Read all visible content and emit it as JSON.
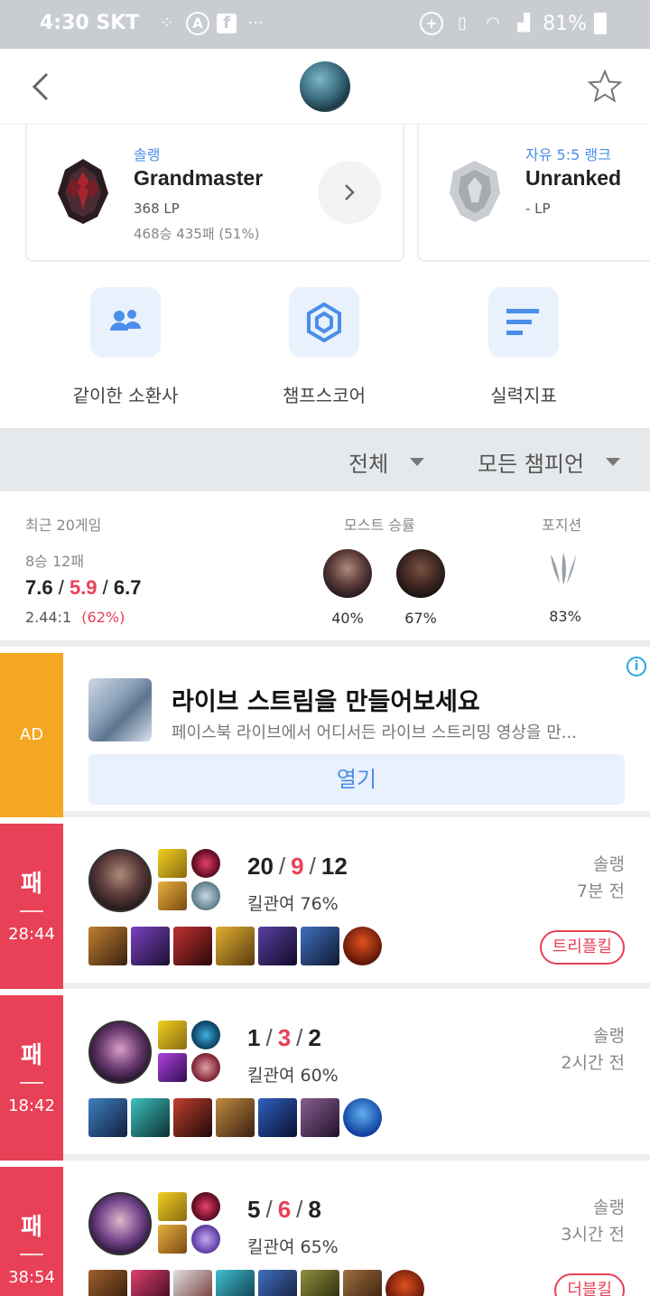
{
  "status_bar": {
    "time": "4:30 SKT",
    "battery": "81%"
  },
  "rank": {
    "solo": {
      "queue": "솔랭",
      "tier": "Grandmaster",
      "lp": "368 LP",
      "record": "468승 435패 (51%)"
    },
    "flex": {
      "queue": "자유 5:5 랭크",
      "tier": "Unranked",
      "lp": "- LP"
    }
  },
  "quick_menu": [
    {
      "label": "같이한 소환사",
      "icon": "people-icon"
    },
    {
      "label": "챔프스코어",
      "icon": "hexagon-icon"
    },
    {
      "label": "실력지표",
      "icon": "bars-icon"
    }
  ],
  "filters": {
    "queue": "전체",
    "champion": "모든 챔피언"
  },
  "summary": {
    "recent_label": "최근 20게임",
    "record": "8승 12패",
    "kda": {
      "kills": "7.6",
      "deaths": "5.9",
      "assists": "6.7"
    },
    "ratio": "2.44:1",
    "kill_part": "(62%)",
    "most_winrate_label": "모스트 승률",
    "most_champs": [
      {
        "pct": "40%"
      },
      {
        "pct": "67%"
      }
    ],
    "position_label": "포지션",
    "position_pct": "83%"
  },
  "ad": {
    "tag": "AD",
    "title": "라이브 스트림을 만들어보세요",
    "desc": "페이스북 라이브에서 어디서든 라이브 스트리밍 영상을 만...",
    "button": "열기"
  },
  "matches": [
    {
      "result": "패",
      "duration": "28:44",
      "kills": "20",
      "deaths": "9",
      "assists": "12",
      "kp": "킬관여 76%",
      "queue": "솔랭",
      "ago": "7분 전",
      "badge": "트리플킬"
    },
    {
      "result": "패",
      "duration": "18:42",
      "kills": "1",
      "deaths": "3",
      "assists": "2",
      "kp": "킬관여 60%",
      "queue": "솔랭",
      "ago": "2시간 전",
      "badge": ""
    },
    {
      "result": "패",
      "duration": "38:54",
      "kills": "5",
      "deaths": "6",
      "assists": "8",
      "kp": "킬관여 65%",
      "queue": "솔랭",
      "ago": "3시간 전",
      "badge": "더블킬"
    }
  ],
  "colors": {
    "loss": "#e84057",
    "accent": "#4a8ee8",
    "ad": "#f5a623"
  }
}
